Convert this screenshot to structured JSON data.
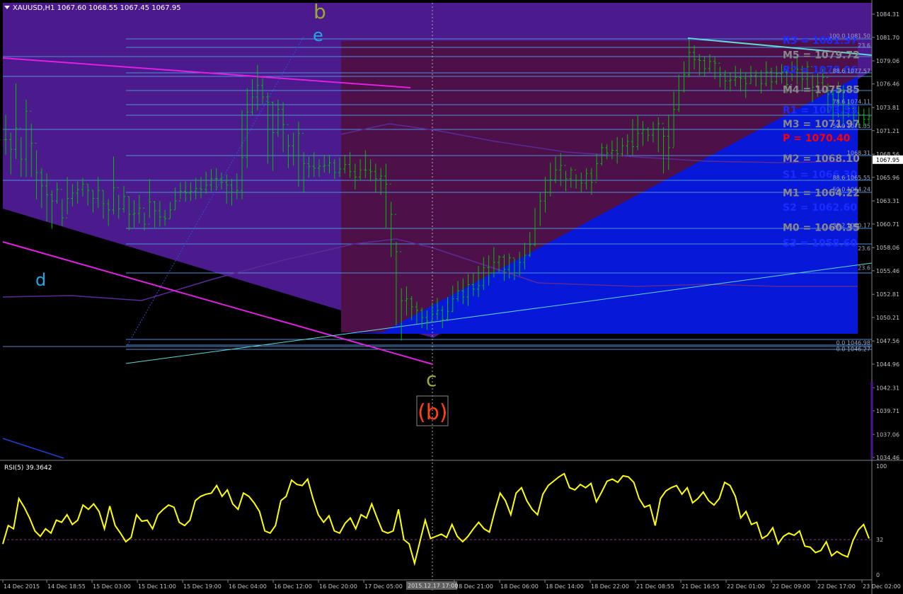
{
  "header": {
    "symbol_info": "XAUUSD,H1  1067.60 1068.55 1067.45 1067.95",
    "rsi_label": "RSI(5) 39.3642"
  },
  "colors": {
    "background": "#000000",
    "candle": "#00c000",
    "purple_zone": "#4b1a8c",
    "maroon_zone": "#4e1048",
    "blue_zone": "#0818d8",
    "fib_line": "#4f8fd6",
    "magenta_line": "#e020e0",
    "cyan_line": "#60d8d8",
    "rsi_line": "#ffff00",
    "grid_text": "#c0c0c0",
    "pivot_R": "#1a2cff",
    "pivot_M": "#888888",
    "pivot_P": "#ff0000"
  },
  "wave_labels": {
    "b": "b",
    "e": "e",
    "d": "d",
    "c": "c",
    "paren_b": "(b)"
  },
  "pivots": [
    {
      "label": "R3 = 1081.37",
      "price": 1081.37,
      "kind": "R"
    },
    {
      "label": "M5 = 1079.72",
      "price": 1079.72,
      "kind": "M"
    },
    {
      "label": "R2 = 1078.06",
      "price": 1078.06,
      "kind": "R"
    },
    {
      "label": "M4 = 1075.85",
      "price": 1075.85,
      "kind": "M"
    },
    {
      "label": "R1 = 1073.53",
      "price": 1073.53,
      "kind": "R"
    },
    {
      "label": "M3 = 1071.97",
      "price": 1071.97,
      "kind": "M"
    },
    {
      "label": "P  = 1070.40",
      "price": 1070.4,
      "kind": "P"
    },
    {
      "label": "M2 = 1068.10",
      "price": 1068.1,
      "kind": "M"
    },
    {
      "label": "S1 = 1066.30",
      "price": 1066.3,
      "kind": "R"
    },
    {
      "label": "M1 = 1064.22",
      "price": 1064.22,
      "kind": "M"
    },
    {
      "label": "S2 = 1062.60",
      "price": 1062.6,
      "kind": "R"
    },
    {
      "label": "M0 = 1060.35",
      "price": 1060.35,
      "kind": "M"
    },
    {
      "label": "S3 = 1058.60",
      "price": 1058.6,
      "kind": "R"
    }
  ],
  "fib_labels": [
    {
      "text": "100.0 1081.50",
      "price": 1081.5
    },
    {
      "text": "23.6",
      "price": 1080.4
    },
    {
      "text": "88.6 1077.57",
      "price": 1077.57
    },
    {
      "text": "78.6 1074.11",
      "price": 1074.11
    },
    {
      "text": "50.0 1071.35",
      "price": 1071.35
    },
    {
      "text": "1068.31",
      "price": 1068.31
    },
    {
      "text": "88.6 1065.55",
      "price": 1065.55
    },
    {
      "text": "50.0 1064.24",
      "price": 1064.24
    },
    {
      "text": "38.2 1060.17",
      "price": 1060.17
    },
    {
      "text": "23.6",
      "price": 1057.6
    },
    {
      "text": "23.6",
      "price": 1055.4
    },
    {
      "text": "0.0 1046.98",
      "price": 1046.98
    },
    {
      "text": "0.0 1046.27",
      "price": 1046.27
    }
  ],
  "price_axis_ticks": [
    "1084.31",
    "1081.70",
    "1079.06",
    "1076.46",
    "1073.81",
    "1071.21",
    "1068.56",
    "1065.96",
    "1063.31",
    "1060.71",
    "1058.06",
    "1055.46",
    "1052.81",
    "1050.21",
    "1047.56",
    "1044.96",
    "1042.31",
    "1039.71",
    "1037.06",
    "1034.46"
  ],
  "current_price": "1067.95",
  "rsi_axis": {
    "max": "100",
    "level": "32",
    "min": "0"
  },
  "time_labels": [
    "14 Dec 2015",
    "14 Dec 18:55",
    "15 Dec 03:00",
    "15 Dec 11:00",
    "15 Dec 19:00",
    "16 Dec 04:00",
    "16 Dec 12:00",
    "16 Dec 20:00",
    "17 Dec 05:00",
    "2015.12.17 17:00",
    "18 Dec 21:00",
    "18 Dec 06:00",
    "18 Dec 14:00",
    "18 Dec 22:00",
    "21 Dec 08:55",
    "21 Dec 16:55",
    "22 Dec 01:00",
    "22 Dec 09:00",
    "22 Dec 17:00",
    "23 Dec 02:00"
  ],
  "chart_data": {
    "type": "candlestick",
    "title": "XAUUSD,H1",
    "ylim": [
      1034.46,
      1084.31
    ],
    "ohlc_close": [
      1070.2,
      1069.1,
      1071.5,
      1068.0,
      1073.4,
      1069.8,
      1066.5,
      1065.0,
      1064.0,
      1063.3,
      1064.6,
      1061.4,
      1063.6,
      1064.2,
      1064.6,
      1065.2,
      1064.5,
      1063.6,
      1064.5,
      1063.0,
      1062.3,
      1064.8,
      1062.4,
      1063.8,
      1061.8,
      1061.9,
      1062.5,
      1060.7,
      1063.2,
      1062.2,
      1061.5,
      1061.3,
      1062.3,
      1063.3,
      1064.4,
      1064.2,
      1064.4,
      1064.7,
      1064.6,
      1065.1,
      1065.8,
      1065.8,
      1065.4,
      1065.1,
      1064.3,
      1064.5,
      1068.2,
      1073.3,
      1075.0,
      1076.3,
      1075.0,
      1074.4,
      1071.0,
      1073.6,
      1071.9,
      1069.5,
      1068.4,
      1070.9,
      1067.5,
      1067.2,
      1067.0,
      1067.2,
      1067.3,
      1067.6,
      1066.5,
      1066.9,
      1067.4,
      1066.6,
      1066.0,
      1066.8,
      1066.8,
      1066.6,
      1065.8,
      1066.1,
      1065.2,
      1061.8,
      1057.6,
      1052.1,
      1052.3,
      1051.4,
      1051.0,
      1050.2,
      1049.8,
      1050.6,
      1051.0,
      1050.0,
      1050.9,
      1052.3,
      1053.2,
      1052.5,
      1053.9,
      1053.4,
      1053.8,
      1055.8,
      1055.2,
      1056.4,
      1057.0,
      1055.6,
      1056.9,
      1055.2,
      1056.4,
      1057.2,
      1058.4,
      1060.2,
      1063.3,
      1064.3,
      1065.7,
      1066.8,
      1067.3,
      1065.8,
      1066.8,
      1065.6,
      1065.3,
      1066.4,
      1065.4,
      1067.5,
      1069.3,
      1068.7,
      1069.0,
      1068.6,
      1069.5,
      1070.0,
      1069.4,
      1070.9,
      1071.3,
      1070.7,
      1071.4,
      1072.0,
      1070.6,
      1069.3,
      1073.6,
      1075.7,
      1077.5,
      1080.0,
      1079.2,
      1079.1,
      1078.2,
      1079.0,
      1078.8,
      1077.5,
      1076.8,
      1076.9,
      1077.2,
      1077.1,
      1076.5,
      1077.4,
      1077.3,
      1076.5,
      1077.8,
      1076.7,
      1077.6,
      1077.8,
      1076.4,
      1077.8,
      1078.1,
      1077.0,
      1078.4,
      1076.1,
      1076.6,
      1077.2,
      1075.3,
      1074.6,
      1075.5,
      1075.8,
      1073.7,
      1073.2,
      1073.0,
      1072.5,
      1072.8
    ],
    "ohlc_high": [
      1073.0,
      1071.0,
      1076.5,
      1070.5,
      1074.7,
      1072.0,
      1069.0,
      1067.0,
      1066.4,
      1064.5,
      1065.4,
      1063.5,
      1066.0,
      1065.2,
      1065.5,
      1065.9,
      1065.2,
      1064.5,
      1066.0,
      1064.5,
      1063.5,
      1068.3,
      1064.0,
      1065.0,
      1063.8,
      1063.4,
      1064.0,
      1062.0,
      1065.8,
      1063.3,
      1063.3,
      1062.3,
      1063.2,
      1064.8,
      1065.4,
      1065.5,
      1065.4,
      1065.9,
      1066.0,
      1066.6,
      1066.9,
      1067.0,
      1066.5,
      1066.3,
      1065.8,
      1066.4,
      1073.5,
      1076.0,
      1077.0,
      1078.6,
      1077.1,
      1075.5,
      1074.5,
      1074.7,
      1074.4,
      1070.8,
      1071.0,
      1072.2,
      1068.8,
      1068.3,
      1068.8,
      1068.0,
      1068.5,
      1068.5,
      1068.0,
      1068.2,
      1068.5,
      1068.8,
      1067.5,
      1068.0,
      1069.0,
      1068.0,
      1067.5,
      1067.0,
      1067.5,
      1063.2,
      1058.7,
      1053.5,
      1053.7,
      1052.6,
      1052.0,
      1051.3,
      1051.0,
      1051.9,
      1052.4,
      1051.5,
      1052.5,
      1053.8,
      1054.3,
      1054.6,
      1055.1,
      1055.2,
      1056.0,
      1057.0,
      1057.2,
      1058.1,
      1057.2,
      1057.3,
      1057.4,
      1056.8,
      1057.6,
      1058.6,
      1059.8,
      1062.5,
      1064.3,
      1066.0,
      1067.6,
      1068.3,
      1068.7,
      1066.7,
      1067.1,
      1066.3,
      1066.5,
      1067.0,
      1067.0,
      1068.6,
      1069.8,
      1069.7,
      1070.1,
      1070.5,
      1070.4,
      1070.8,
      1072.5,
      1073.0,
      1072.3,
      1071.6,
      1072.2,
      1072.7,
      1071.6,
      1073.0,
      1075.6,
      1077.5,
      1079.0,
      1081.5,
      1080.8,
      1079.8,
      1079.5,
      1079.8,
      1079.5,
      1078.4,
      1078.0,
      1077.8,
      1078.5,
      1078.2,
      1077.8,
      1078.5,
      1078.0,
      1078.0,
      1079.0,
      1078.3,
      1078.5,
      1078.7,
      1078.0,
      1079.0,
      1079.5,
      1078.5,
      1079.0,
      1077.5,
      1077.8,
      1078.2,
      1076.5,
      1076.0,
      1076.7,
      1076.3,
      1074.7,
      1074.0,
      1074.0,
      1073.7,
      1073.8
    ],
    "ohlc_low": [
      1068.5,
      1066.3,
      1068.0,
      1066.0,
      1066.0,
      1066.0,
      1063.5,
      1062.5,
      1061.0,
      1060.2,
      1063.0,
      1060.5,
      1061.8,
      1062.7,
      1063.0,
      1063.8,
      1062.8,
      1062.0,
      1062.5,
      1061.3,
      1060.5,
      1061.8,
      1061.3,
      1062.0,
      1060.0,
      1060.3,
      1060.8,
      1060.0,
      1061.4,
      1060.3,
      1060.4,
      1060.5,
      1061.3,
      1062.3,
      1063.5,
      1063.2,
      1063.3,
      1063.5,
      1063.6,
      1064.1,
      1064.4,
      1064.5,
      1064.6,
      1063.0,
      1062.8,
      1063.5,
      1063.5,
      1067.0,
      1073.0,
      1073.5,
      1074.2,
      1067.5,
      1066.7,
      1070.5,
      1068.8,
      1067.0,
      1067.3,
      1064.9,
      1064.3,
      1065.9,
      1066.0,
      1066.0,
      1066.5,
      1066.4,
      1065.8,
      1066.0,
      1066.4,
      1065.9,
      1064.6,
      1065.6,
      1065.9,
      1065.5,
      1064.3,
      1064.0,
      1060.2,
      1057.0,
      1049.3,
      1047.6,
      1050.4,
      1049.9,
      1049.5,
      1049.0,
      1048.8,
      1049.6,
      1049.9,
      1049.0,
      1049.8,
      1050.8,
      1052.0,
      1051.7,
      1051.5,
      1052.6,
      1052.5,
      1053.3,
      1053.8,
      1054.7,
      1055.3,
      1054.3,
      1054.6,
      1054.4,
      1054.9,
      1055.6,
      1057.0,
      1058.2,
      1060.5,
      1062.0,
      1063.8,
      1065.3,
      1065.0,
      1064.4,
      1064.8,
      1064.7,
      1064.2,
      1064.6,
      1064.0,
      1065.6,
      1067.3,
      1068.0,
      1068.0,
      1067.5,
      1068.3,
      1068.5,
      1068.4,
      1069.0,
      1069.5,
      1070.0,
      1069.9,
      1068.8,
      1066.4,
      1066.8,
      1069.4,
      1073.3,
      1075.5,
      1077.2,
      1078.1,
      1077.4,
      1077.3,
      1077.8,
      1077.0,
      1076.1,
      1075.8,
      1075.6,
      1076.2,
      1075.6,
      1074.9,
      1076.5,
      1076.2,
      1075.4,
      1076.2,
      1075.7,
      1076.4,
      1076.5,
      1075.4,
      1076.8,
      1076.4,
      1075.6,
      1075.8,
      1074.4,
      1075.0,
      1075.5,
      1073.2,
      1072.5,
      1072.7,
      1072.0,
      1072.7,
      1072.0,
      1071.6,
      1071.6,
      1072.0
    ],
    "rsi_values": [
      28,
      45,
      42,
      70,
      62,
      52,
      40,
      35,
      42,
      38,
      50,
      48,
      55,
      46,
      50,
      64,
      60,
      65,
      58,
      42,
      63,
      45,
      38,
      30,
      34,
      55,
      49,
      50,
      42,
      55,
      60,
      64,
      62,
      48,
      45,
      50,
      68,
      72,
      74,
      75,
      82,
      72,
      78,
      65,
      60,
      75,
      72,
      66,
      58,
      40,
      38,
      45,
      68,
      72,
      87,
      83,
      82,
      88,
      70,
      55,
      48,
      54,
      40,
      38,
      47,
      52,
      42,
      55,
      52,
      65,
      52,
      40,
      38,
      40,
      60,
      32,
      28,
      10,
      30,
      50,
      33,
      35,
      37,
      34,
      46,
      35,
      30,
      35,
      42,
      48,
      42,
      39,
      58,
      75,
      68,
      55,
      75,
      80,
      68,
      60,
      55,
      74,
      82,
      86,
      90,
      93,
      80,
      78,
      83,
      80,
      84,
      67,
      76,
      86,
      88,
      85,
      91,
      90,
      85,
      70,
      62,
      64,
      45,
      70,
      77,
      80,
      82,
      74,
      80,
      66,
      70,
      76,
      68,
      64,
      70,
      85,
      82,
      72,
      52,
      58,
      46,
      48,
      33,
      36,
      43,
      28,
      35,
      38,
      36,
      40,
      26,
      25,
      20,
      22,
      30,
      17,
      21,
      18,
      16,
      31,
      41,
      46,
      33
    ],
    "series": [
      {
        "name": "RSI(5)",
        "values_key": "rsi_values",
        "current": 39.3642
      }
    ],
    "rsi_ylim": [
      0,
      100
    ],
    "rsi_level": 32
  }
}
